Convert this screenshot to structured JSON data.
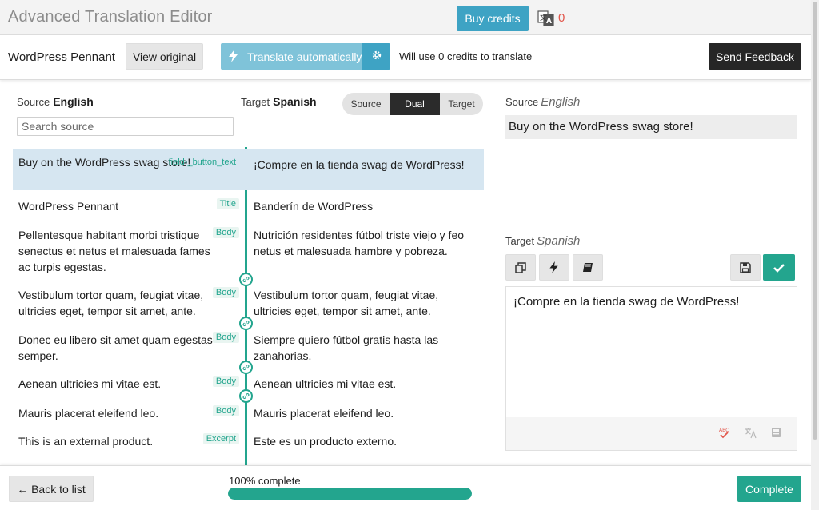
{
  "app": {
    "title": "Advanced Translation Editor",
    "buy_credits_label": "Buy credits",
    "credits_count": "0"
  },
  "toolbar": {
    "document_title": "WordPress Pennant",
    "view_original_label": "View original",
    "translate_auto_label": "Translate automatically",
    "credits_note": "Will use 0 credits to translate",
    "send_feedback_label": "Send Feedback"
  },
  "left_pane": {
    "source_prefix": "Source",
    "source_language": "English",
    "target_prefix": "Target",
    "target_language": "Spanish",
    "mode_options": [
      "Source",
      "Dual",
      "Target"
    ],
    "active_mode": "Dual",
    "search_placeholder": "Search source"
  },
  "rows": [
    {
      "source": "Buy on the WordPress swag store!",
      "field": "field-_button_text",
      "target": "¡Compre en la tienda swag de WordPress!",
      "selected": true
    },
    {
      "source": "WordPress Pennant",
      "field": "Title",
      "target": "Banderín de WordPress",
      "selected": false
    },
    {
      "source": "Pellentesque habitant morbi tristique senectus et netus et malesuada fames ac turpis egestas.",
      "field": "Body",
      "target": "Nutrición residentes fútbol triste viejo y feo netus et malesuada hambre y pobreza.",
      "selected": false
    },
    {
      "source": "Vestibulum tortor quam, feugiat vitae, ultricies eget, tempor sit amet, ante.",
      "field": "Body",
      "target": "Vestibulum tortor quam, feugiat vitae, ultricies eget, tempor sit amet, ante.",
      "selected": false
    },
    {
      "source": "Donec eu libero sit amet quam egestas semper.",
      "field": "Body",
      "target": "Siempre quiero fútbol gratis hasta las zanahorias.",
      "selected": false
    },
    {
      "source": "Aenean ultricies mi vitae est.",
      "field": "Body",
      "target": "Aenean ultricies mi vitae est.",
      "selected": false
    },
    {
      "source": "Mauris placerat eleifend leo.",
      "field": "Body",
      "target": "Mauris placerat eleifend leo.",
      "selected": false
    },
    {
      "source": "This is an external product.",
      "field": "Excerpt",
      "target": "Este es un producto externo.",
      "selected": false
    }
  ],
  "right_pane": {
    "source_prefix": "Source",
    "source_language": "English",
    "source_text": "Buy on the WordPress swag store!",
    "target_prefix": "Target",
    "target_language": "Spanish",
    "target_text": "¡Compre en la tienda swag de WordPress!"
  },
  "footer": {
    "back_label": "← Back to list",
    "progress_label": "100% complete",
    "progress_fraction": 1.0,
    "complete_label": "Complete"
  },
  "colors": {
    "accent_teal": "#23a58e",
    "button_blue": "#3ea3c4",
    "selected_row": "#d6e6f1",
    "credits_red": "#e2574c"
  }
}
